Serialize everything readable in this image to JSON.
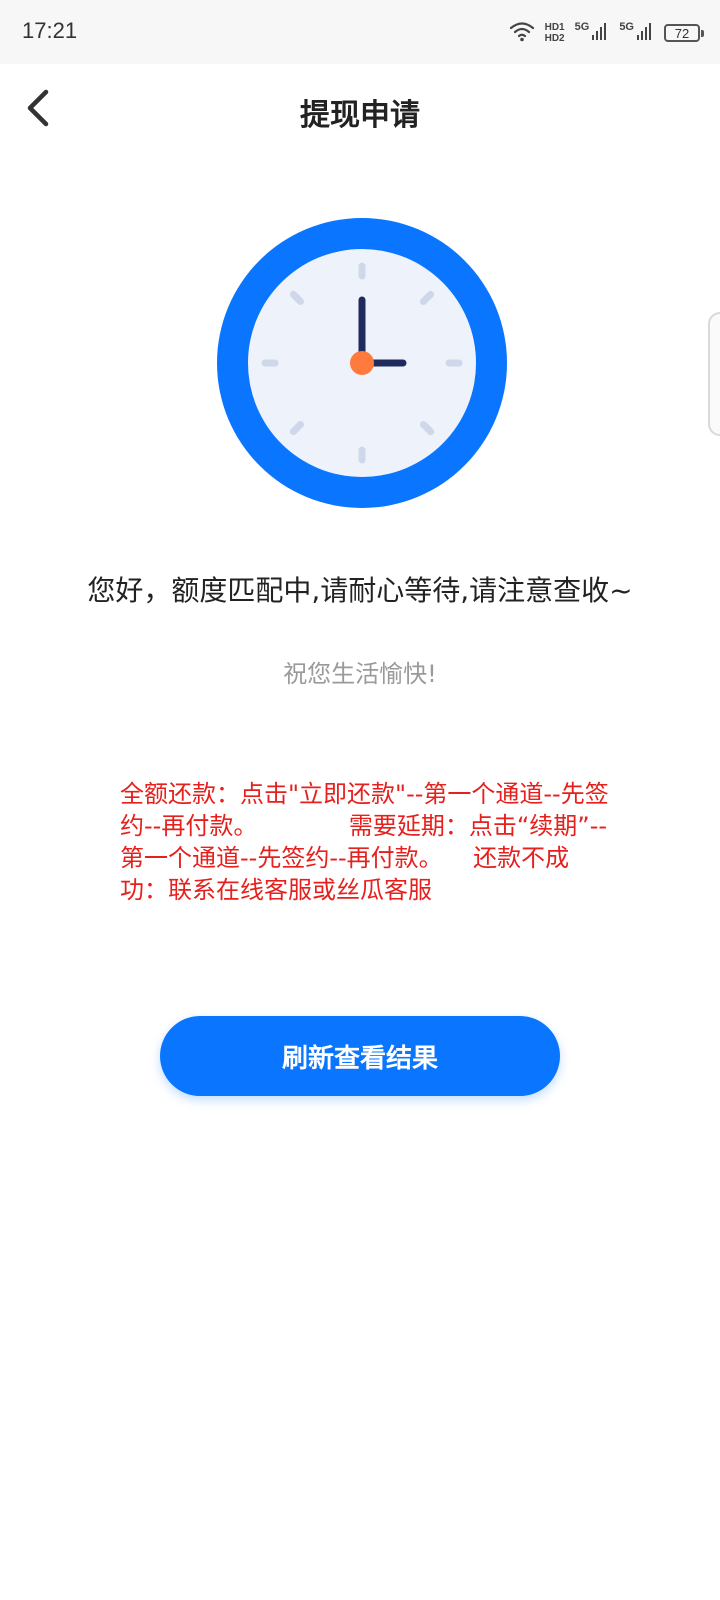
{
  "status_bar": {
    "time": "17:21",
    "hd_top": "HD1",
    "hd_bottom": "HD2",
    "net1": "5G",
    "net2": "5G",
    "battery": "72"
  },
  "header": {
    "title": "提现申请",
    "back_icon": "chevron-left-icon"
  },
  "status": {
    "icon": "clock-icon",
    "message": "您好，额度匹配中,请耐心等待,请注意查收~",
    "wish": "祝您生活愉快!",
    "notice": "全额还款：点击\"立即还款\"--第一个通道--先签约--再付款。            需要延期：点击“续期”--第一个通道--先签约--再付款。    还款不成功：联系在线客服或丝瓜客服"
  },
  "actions": {
    "refresh_label": "刷新查看结果"
  },
  "colors": {
    "accent": "#0a76ff",
    "notice_red": "#e6201c",
    "clock_face": "#eef3fb",
    "clock_hand": "#1e2b5c",
    "clock_center": "#ff7a3d"
  }
}
